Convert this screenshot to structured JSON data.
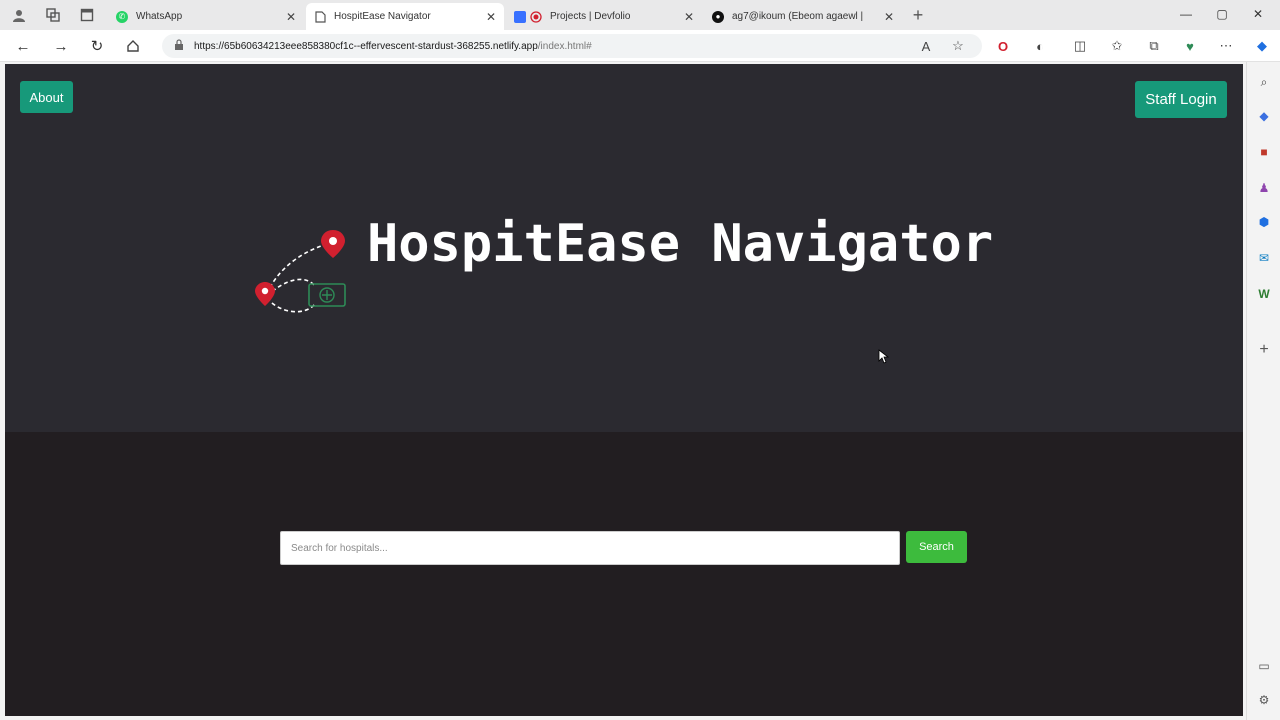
{
  "browser": {
    "tabs": [
      {
        "title": "WhatsApp",
        "favicon": "whatsapp-icon",
        "color": "#25d366"
      },
      {
        "title": "HospitEase Navigator",
        "favicon": "page-icon",
        "color": "#666666"
      },
      {
        "title": "Projects | Devfolio",
        "favicon": "devfolio-icon",
        "color": "#3770ff"
      },
      {
        "title": "ag7@ikoum (Ebeom agaewl | ",
        "favicon": "github-icon",
        "color": "#111111"
      }
    ],
    "url_host": "https://65b60634213eee858380cf1c--effervescent-stardust-368255.netlify.app",
    "url_path": "/index.html#"
  },
  "page": {
    "about_label": "About",
    "staff_login_label": "Staff Login",
    "brand_title": "HospitEase Navigator",
    "search_placeholder": "Search for hospitals...",
    "search_button_label": "Search"
  },
  "colors": {
    "hero_bg": "#2b2a30",
    "lower_bg": "#221e21",
    "accent_teal": "#17997a",
    "search_green": "#3dbb3d",
    "pin_red": "#d1202f"
  }
}
